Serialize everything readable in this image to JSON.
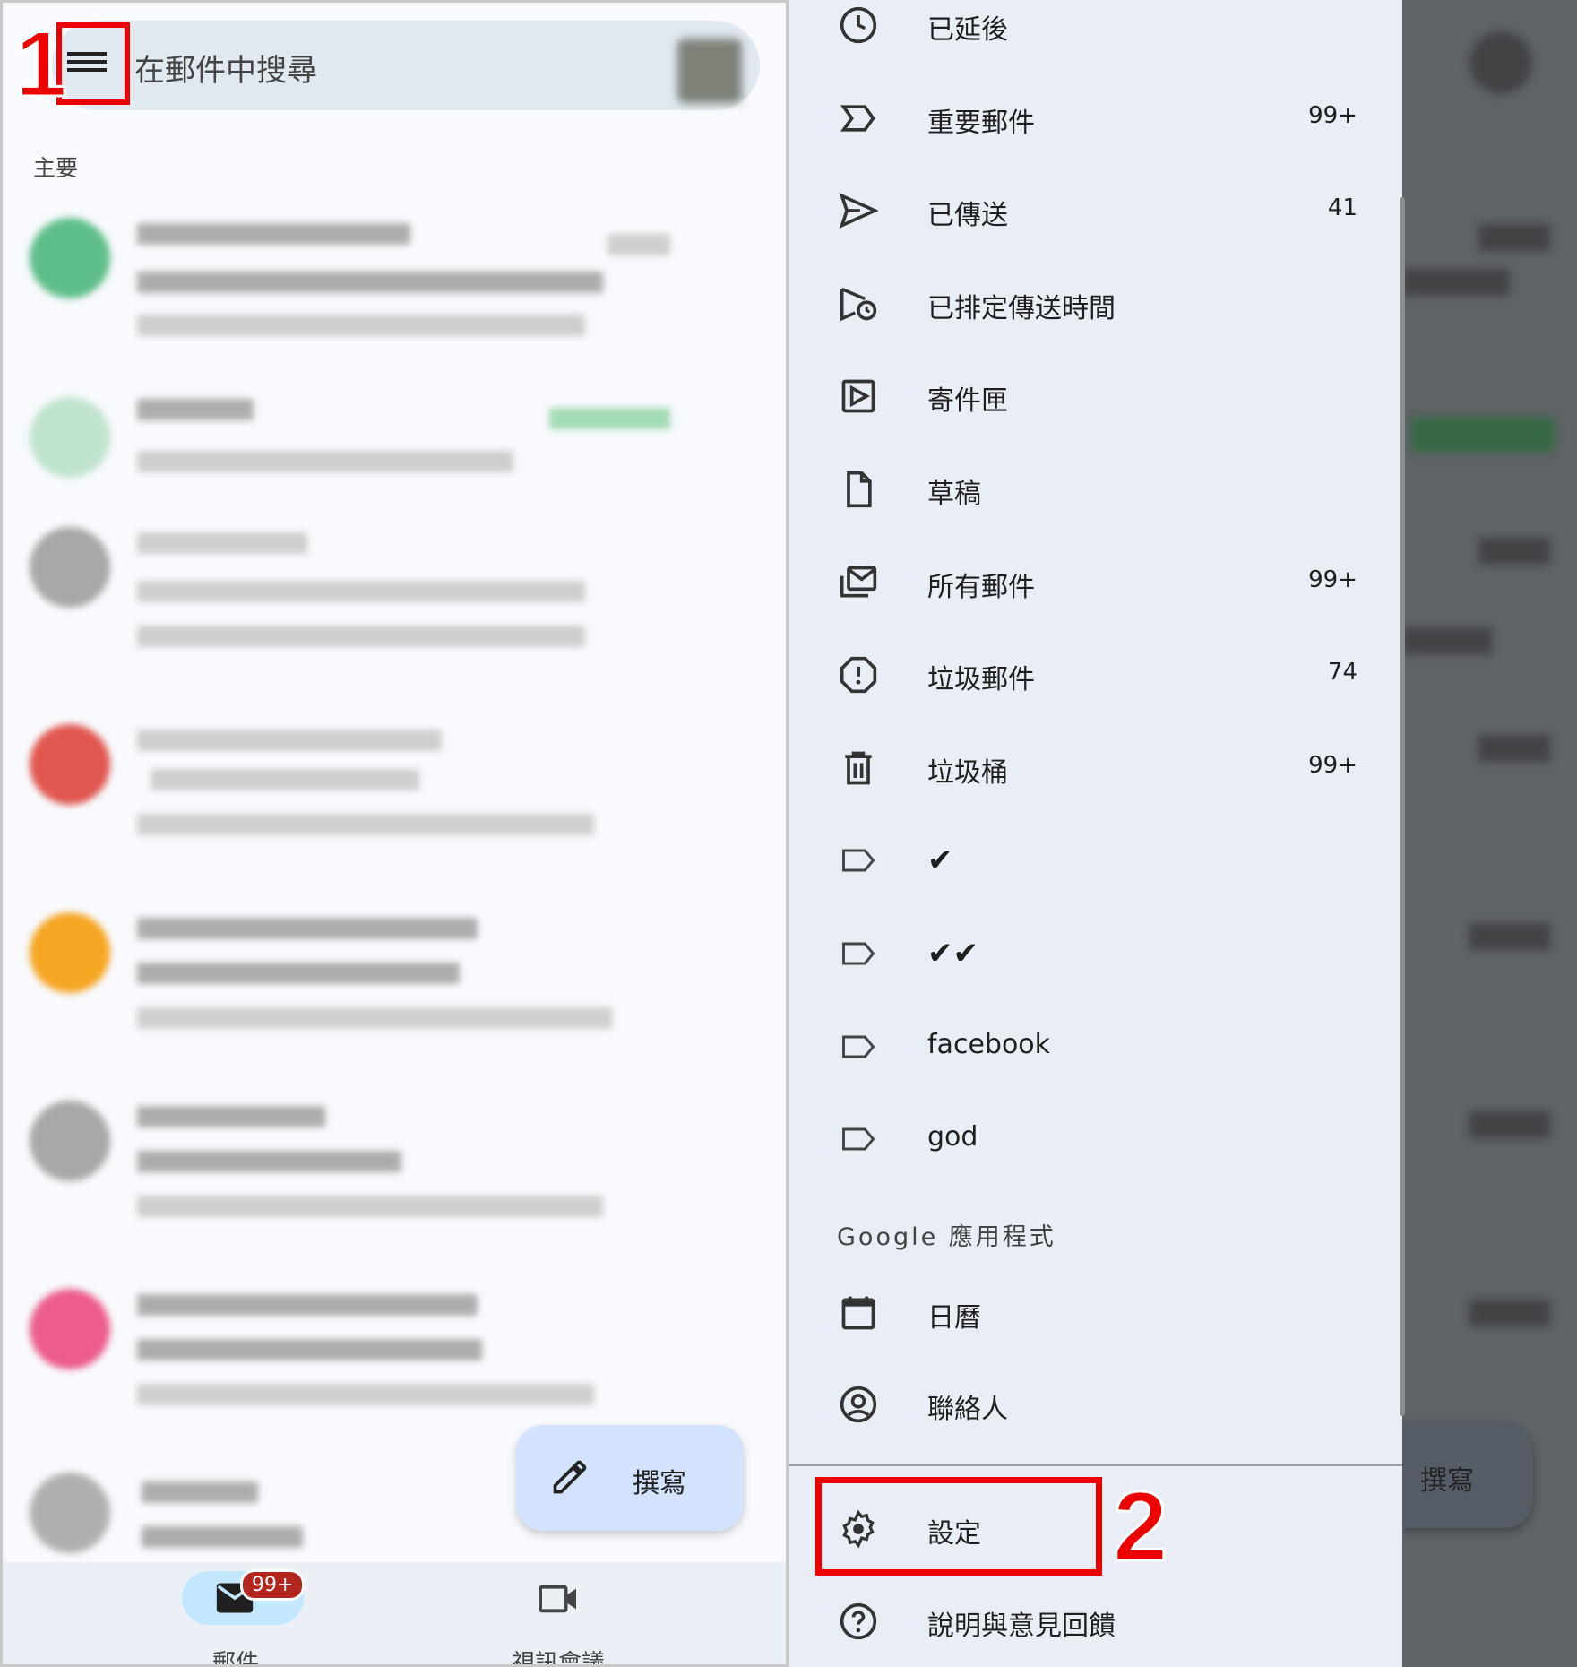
{
  "search": {
    "placeholder": "在郵件中搜尋"
  },
  "annotations": {
    "step1": "1",
    "step2": "2"
  },
  "inbox": {
    "section_label": "主要"
  },
  "compose": {
    "label": "撰寫"
  },
  "bottom_nav": {
    "mail_label": "郵件",
    "mail_badge": "99+",
    "meet_label": "視訊會議"
  },
  "drawer": {
    "items": [
      {
        "label": "已延後",
        "count": "",
        "icon": "clock-icon"
      },
      {
        "label": "重要郵件",
        "count": "99+",
        "icon": "important-icon"
      },
      {
        "label": "已傳送",
        "count": "41",
        "icon": "send-icon"
      },
      {
        "label": "已排定傳送時間",
        "count": "",
        "icon": "scheduled-send-icon"
      },
      {
        "label": "寄件匣",
        "count": "",
        "icon": "outbox-icon"
      },
      {
        "label": "草稿",
        "count": "",
        "icon": "draft-icon"
      },
      {
        "label": "所有郵件",
        "count": "99+",
        "icon": "all-mail-icon"
      },
      {
        "label": "垃圾郵件",
        "count": "74",
        "icon": "spam-icon"
      },
      {
        "label": "垃圾桶",
        "count": "99+",
        "icon": "trash-icon"
      },
      {
        "label": "✔",
        "count": "",
        "icon": "label-icon"
      },
      {
        "label": "✔✔",
        "count": "",
        "icon": "label-icon"
      },
      {
        "label": "facebook",
        "count": "",
        "icon": "label-icon"
      },
      {
        "label": "god",
        "count": "",
        "icon": "label-icon"
      }
    ],
    "google_apps_header": "Google 應用程式",
    "apps": [
      {
        "label": "日曆",
        "icon": "calendar-icon"
      },
      {
        "label": "聯絡人",
        "icon": "contacts-icon"
      }
    ],
    "settings": {
      "label": "設定",
      "icon": "gear-icon"
    },
    "help": {
      "label": "說明與意見回饋",
      "icon": "help-icon"
    }
  },
  "colors": {
    "highlight": "#ee0000",
    "drawer_bg": "#e9eef6",
    "compose_bg": "#d3e3fd",
    "badge": "#b3261e"
  }
}
